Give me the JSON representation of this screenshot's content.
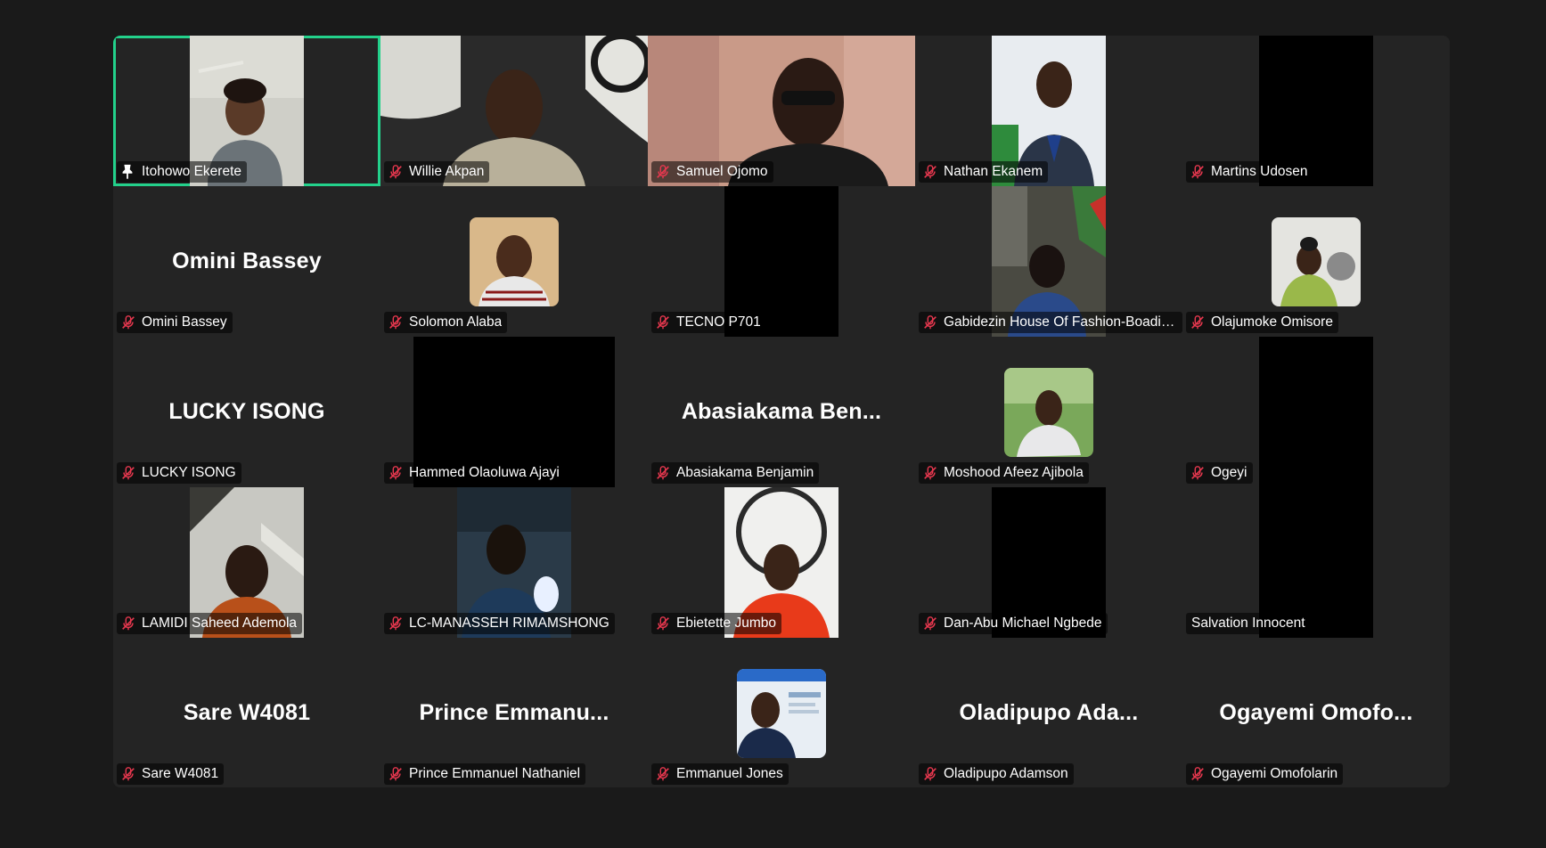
{
  "meeting": {
    "accent_color": "#23d18b",
    "muted_icon_color": "#e8384f",
    "participants": [
      {
        "name": "Itohowo Ekerete",
        "display": "video",
        "muted": false,
        "pinned": true,
        "speaking": true
      },
      {
        "name": "Willie Akpan",
        "display": "video",
        "muted": true
      },
      {
        "name": "Samuel Ojomo",
        "display": "video",
        "muted": true
      },
      {
        "name": "Nathan Ekanem",
        "display": "video",
        "muted": true
      },
      {
        "name": "Martins Udosen",
        "display": "black-video",
        "muted": true
      },
      {
        "name": "Omini Bassey",
        "display": "name-only",
        "big_name": "Omini Bassey",
        "muted": true
      },
      {
        "name": "Solomon Alaba",
        "display": "avatar",
        "muted": true
      },
      {
        "name": "TECNO P701",
        "display": "black-video",
        "muted": true
      },
      {
        "name": "Gabidezin House Of Fashion-Boadi A...",
        "display": "video",
        "muted": true
      },
      {
        "name": "Olajumoke Omisore",
        "display": "avatar",
        "muted": true
      },
      {
        "name": "LUCKY ISONG",
        "display": "name-only",
        "big_name": "LUCKY ISONG",
        "muted": true
      },
      {
        "name": "Hammed Olaoluwa Ajayi",
        "display": "black-video",
        "muted": true
      },
      {
        "name": "Abasiakama Benjamin",
        "display": "name-only",
        "big_name": "Abasiakama  Ben...",
        "muted": true
      },
      {
        "name": "Moshood Afeez Ajibola",
        "display": "avatar",
        "muted": true
      },
      {
        "name": "Ogeyi",
        "display": "black-video",
        "muted": true
      },
      {
        "name": "LAMIDI Saheed Ademola",
        "display": "video",
        "muted": true
      },
      {
        "name": "LC-MANASSEH RIMAMSHONG",
        "display": "video",
        "muted": true
      },
      {
        "name": "Ebietette Jumbo",
        "display": "video",
        "muted": true
      },
      {
        "name": "Dan-Abu Michael Ngbede",
        "display": "black-video",
        "muted": true
      },
      {
        "name": "Salvation Innocent",
        "display": "black-video",
        "muted": false
      },
      {
        "name": "Sare W4081",
        "display": "name-only",
        "big_name": "Sare W4081",
        "muted": true
      },
      {
        "name": "Prince Emmanuel Nathaniel",
        "display": "name-only",
        "big_name": "Prince  Emmanu...",
        "muted": true
      },
      {
        "name": "Emmanuel Jones",
        "display": "avatar",
        "muted": true
      },
      {
        "name": "Oladipupo Adamson",
        "display": "name-only",
        "big_name": "Oladipupo  Ada...",
        "muted": true
      },
      {
        "name": "Ogayemi Omofolarin",
        "display": "name-only",
        "big_name": "Ogayemi  Omofo...",
        "muted": true
      }
    ]
  }
}
